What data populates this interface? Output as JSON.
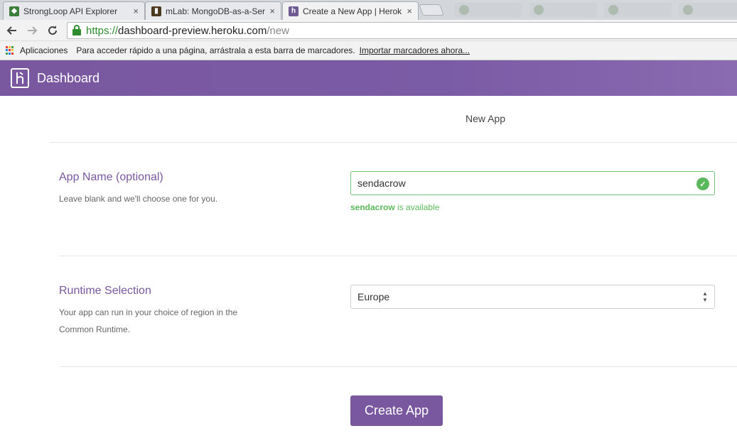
{
  "browser": {
    "tabs": [
      {
        "title": "StrongLoop API Explorer",
        "close": "×"
      },
      {
        "title": "mLab: MongoDB-as-a-Ser",
        "close": "×"
      },
      {
        "title": "Create a New App | Herok",
        "close": "×"
      }
    ],
    "url": {
      "scheme": "https://",
      "host": "dashboard-preview.heroku.com",
      "path": "/new"
    },
    "bookmarks": {
      "apps_label": "Aplicaciones",
      "hint": "Para acceder rápido a una página, arrástrala a esta barra de marcadores.",
      "import_link": "Importar marcadores ahora..."
    }
  },
  "header": {
    "logo_letter": "h",
    "title": "Dashboard",
    "color": "#79589f"
  },
  "page": {
    "heading": "New App"
  },
  "app_name": {
    "title": "App Name (optional)",
    "description": "Leave blank and we'll choose one for you.",
    "value": "sendacrow",
    "status_name": "sendacrow",
    "status_suffix": " is available",
    "status_color": "#5cb85c"
  },
  "runtime": {
    "title": "Runtime Selection",
    "description_line1": "Your app can run in your choice of region in the",
    "description_line2": "Common Runtime.",
    "selected": "Europe"
  },
  "actions": {
    "create_label": "Create App"
  },
  "icons": [
    "back-arrow-icon",
    "forward-arrow-icon",
    "reload-icon",
    "lock-icon",
    "apps-grid-icon",
    "heroku-logo-icon",
    "check-circle-icon",
    "select-chevrons-icon"
  ]
}
